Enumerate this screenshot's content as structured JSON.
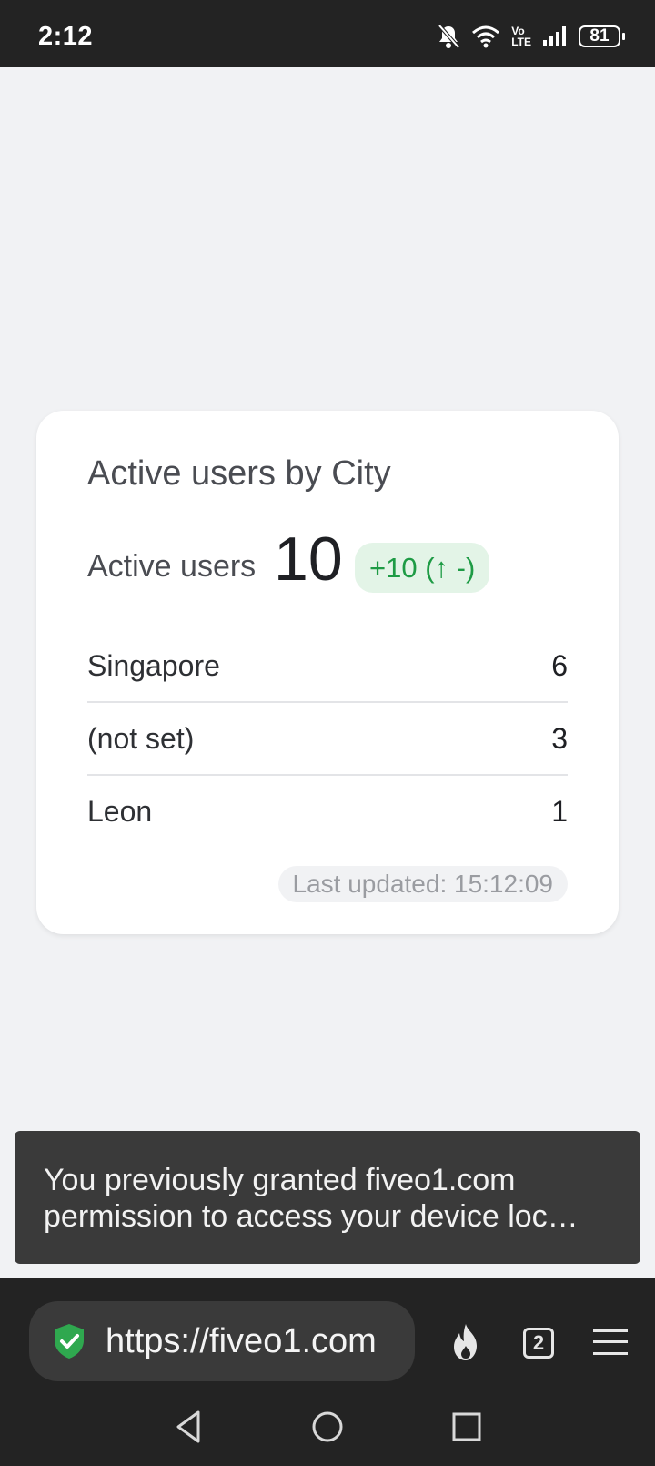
{
  "status_bar": {
    "time": "2:12",
    "battery": "81",
    "volte_top": "Vo",
    "volte_bottom": "LTE"
  },
  "card": {
    "title": "Active users by City",
    "metric_label": "Active users",
    "metric_value": "10",
    "metric_change": "+10 (↑ -)",
    "rows": [
      {
        "city": "Singapore",
        "value": "6"
      },
      {
        "city": "(not set)",
        "value": "3"
      },
      {
        "city": "Leon",
        "value": "1"
      }
    ],
    "last_updated": "Last updated: 15:12:09"
  },
  "snackbar": {
    "message": "You previously granted fiveo1.com permission to access your device loc…"
  },
  "browser": {
    "url": "https://fiveo1.com",
    "tab_count": "2"
  },
  "colors": {
    "accent_green": "#1e9b45",
    "badge_bg": "#e3f4e7",
    "shield_green": "#2fa84f"
  }
}
